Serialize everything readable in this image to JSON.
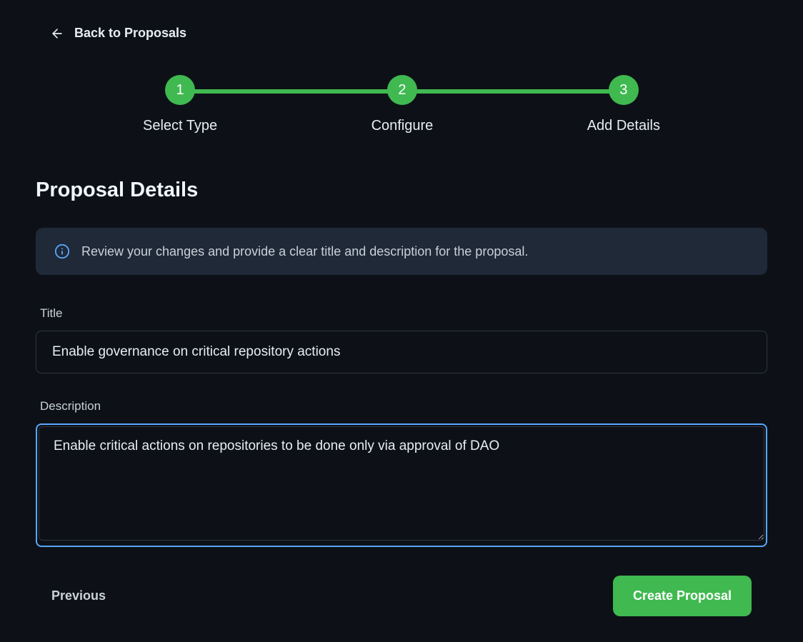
{
  "header": {
    "back_label": "Back to Proposals"
  },
  "stepper": {
    "steps": [
      {
        "num": "1",
        "label": "Select Type"
      },
      {
        "num": "2",
        "label": "Configure"
      },
      {
        "num": "3",
        "label": "Add Details"
      }
    ]
  },
  "section": {
    "title": "Proposal Details"
  },
  "info": {
    "text": "Review your changes and provide a clear title and description for the proposal."
  },
  "form": {
    "title_label": "Title",
    "title_value": "Enable governance on critical repository actions",
    "description_label": "Description",
    "description_value": "Enable critical actions on repositories to be done only via approval of DAO"
  },
  "buttons": {
    "previous": "Previous",
    "create": "Create Proposal"
  }
}
